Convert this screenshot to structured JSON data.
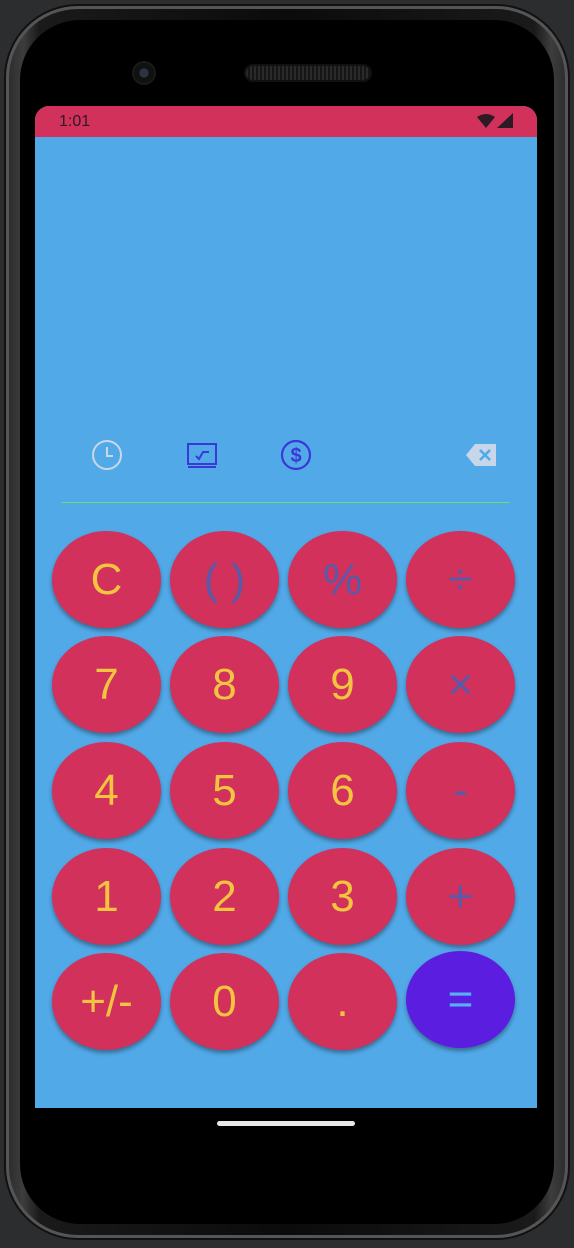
{
  "status_bar": {
    "time": "1:01",
    "wifi_icon": "wifi-icon",
    "signal_icon": "cell-signal-icon",
    "color": "#d1315b"
  },
  "toolbar": {
    "icons": [
      "history-icon",
      "unit-converter-icon",
      "currency-icon",
      "backspace-icon"
    ]
  },
  "keypad": {
    "rows": [
      [
        "C",
        "( )",
        "%",
        "÷"
      ],
      [
        "7",
        "8",
        "9",
        "×"
      ],
      [
        "4",
        "5",
        "6",
        "-"
      ],
      [
        "1",
        "2",
        "3",
        "+"
      ],
      [
        "+/-",
        "0",
        ".",
        "="
      ]
    ]
  },
  "colors": {
    "background": "#52a9e8",
    "key": "#d1315b",
    "key_text": "#f3c43f",
    "operator_text": "#5a5aa8",
    "equals_key": "#5b1ee0",
    "divider": "#6fdc74"
  }
}
